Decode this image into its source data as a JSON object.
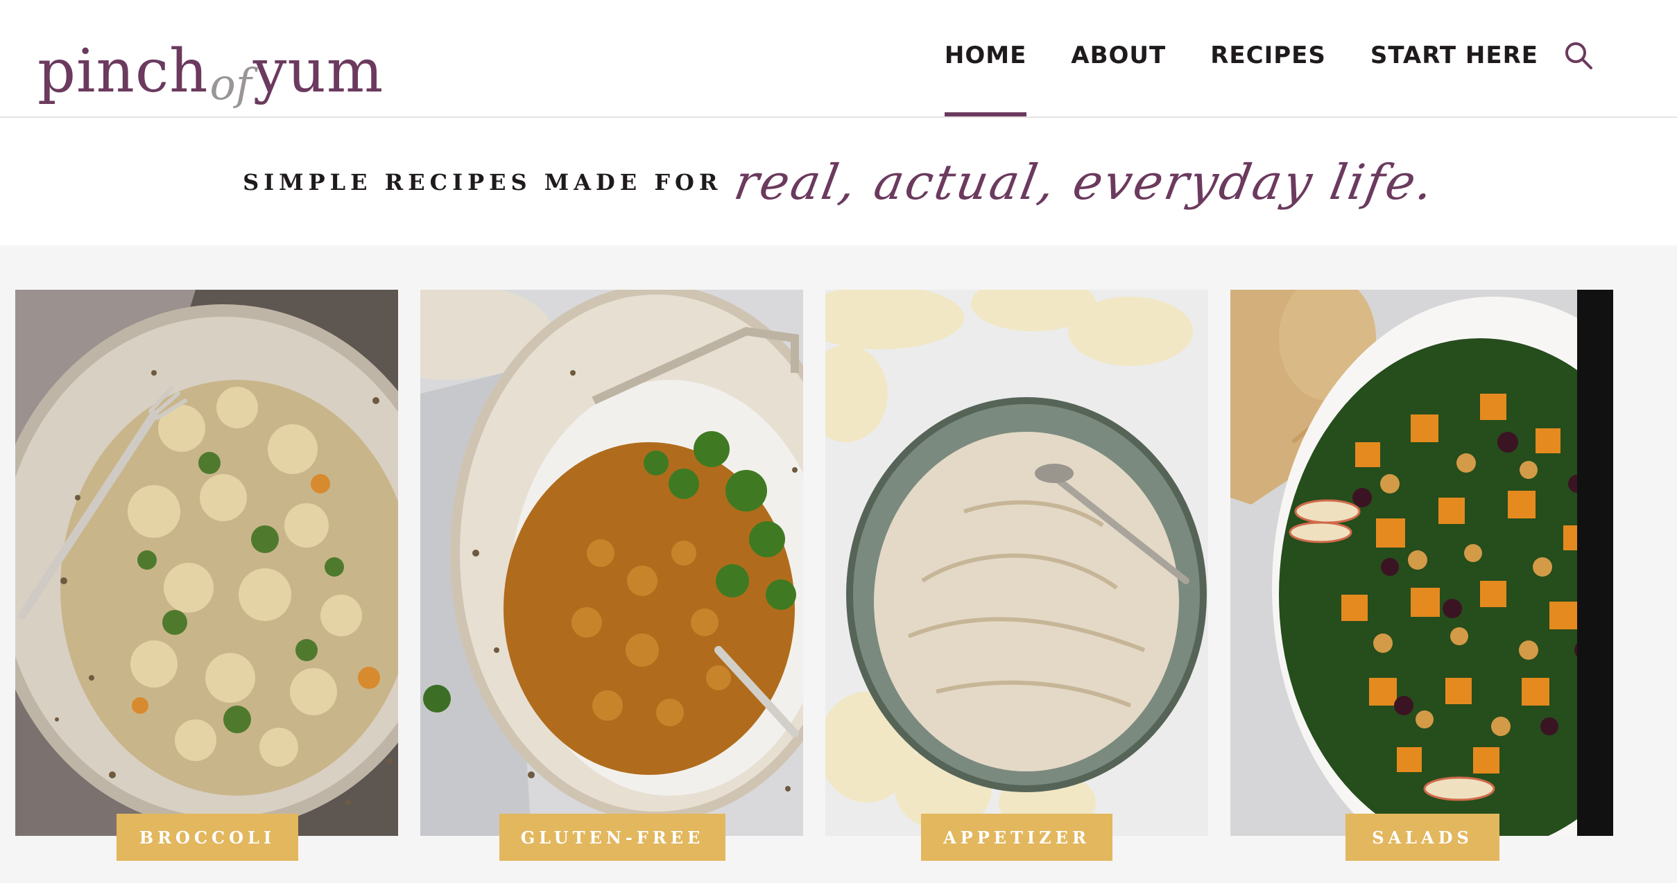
{
  "brand": {
    "logo_part1": "pinch",
    "logo_part2": "of",
    "logo_part3": "yum",
    "color": "#6b3a5e"
  },
  "nav": {
    "items": [
      {
        "label": "HOME",
        "active": true
      },
      {
        "label": "ABOUT",
        "active": false
      },
      {
        "label": "RECIPES",
        "active": false
      },
      {
        "label": "START HERE",
        "active": false
      }
    ],
    "search_icon": "search-icon"
  },
  "tagline": {
    "static": "SIMPLE RECIPES MADE FOR",
    "script": "real, actual, everyday life."
  },
  "categories": [
    {
      "label": "BROCCOLI",
      "image": "pasta-bowl-photo"
    },
    {
      "label": "GLUTEN-FREE",
      "image": "lentil-curry-photo"
    },
    {
      "label": "APPETIZER",
      "image": "onion-dip-photo"
    },
    {
      "label": "SALADS",
      "image": "squash-salad-photo"
    }
  ],
  "colors": {
    "accent": "#e2b75e",
    "background_band": "#f6f5f5"
  }
}
